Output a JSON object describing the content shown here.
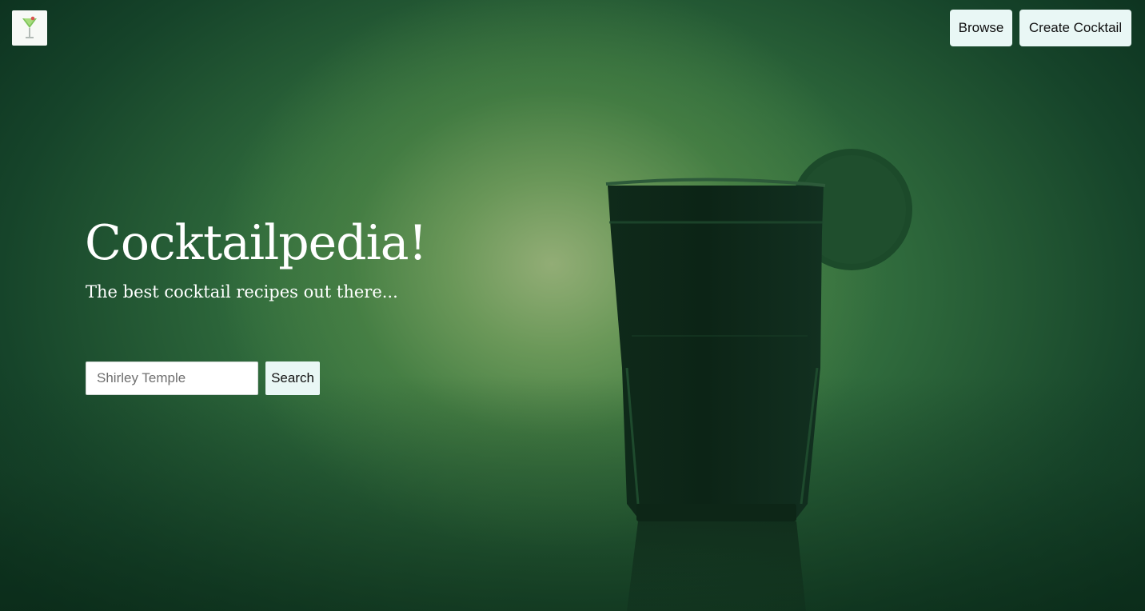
{
  "nav": {
    "logo_icon": "martini-glass-icon",
    "browse_label": "Browse",
    "create_label": "Create Cocktail"
  },
  "hero": {
    "title": "Cocktailpedia!",
    "subtitle": "The best cocktail recipes out there...",
    "background_image": "dark-cocktail-glass-with-lime-wedge"
  },
  "search": {
    "placeholder": "Shirley Temple",
    "button_label": "Search"
  },
  "colors": {
    "button_bg": "#e9f7f5",
    "hero_green": "#2f6a3c",
    "text_white": "#ffffff"
  }
}
